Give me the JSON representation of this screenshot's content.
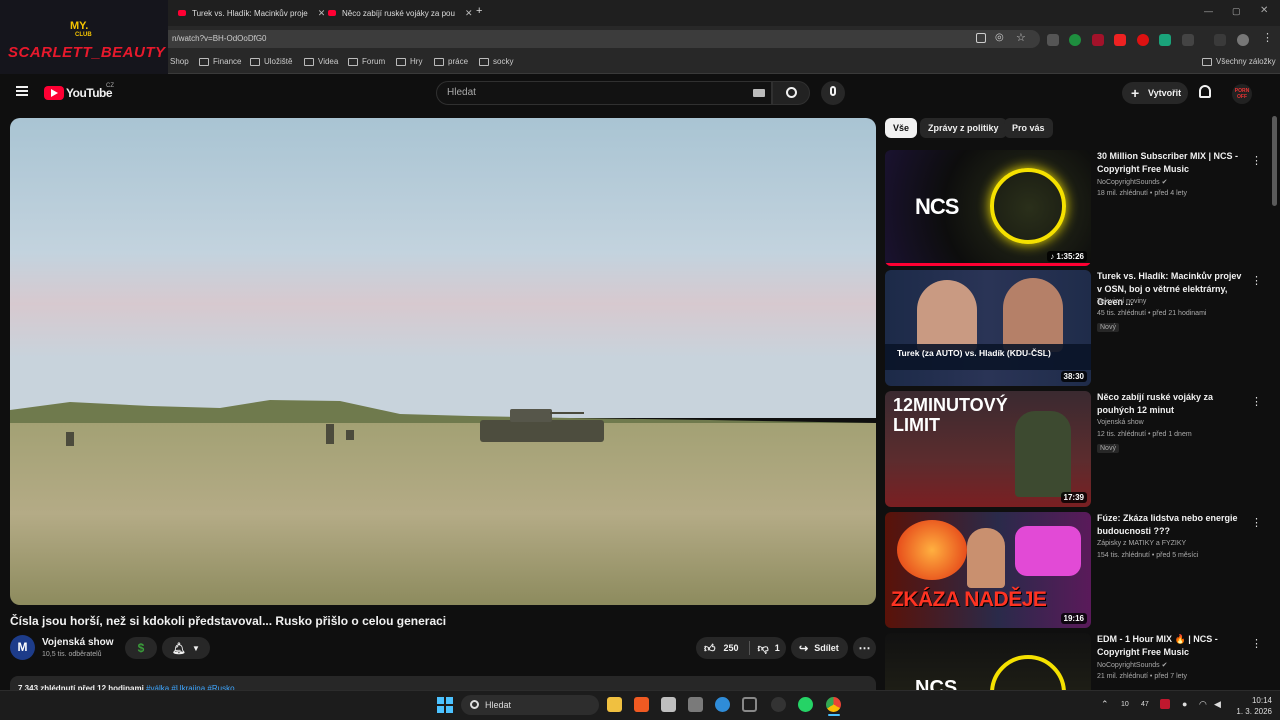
{
  "browser": {
    "tabs": [
      {
        "label": "Turek vs. Hladík: Macinkův proje"
      },
      {
        "label": "Něco zabíjí ruské vojáky za pou"
      }
    ],
    "new_tab_symbol": "+",
    "url": "n/watch?v=BH-OdOoDfG0",
    "bookmarks": [
      "Shop",
      "Finance",
      "Uložiště",
      "Videa",
      "Forum",
      "Hry",
      "práce",
      "socky"
    ],
    "all_bookmarks": "Všechny záložky"
  },
  "overlay": {
    "line1": "MY.",
    "line2": "CLUB",
    "brand": "SCARLETT_BEAUTY"
  },
  "youtube": {
    "logo_text": "YouTube",
    "country": "CZ",
    "search_placeholder": "Hledat",
    "create_label": "Vytvořit",
    "avatar_text": "PORN OFF"
  },
  "video": {
    "title": "Čísla jsou horší, než si kdokoli představoval... Rusko přišlo o celou generaci",
    "channel": "Vojenská show",
    "subscribers": "10,5 tis. odběratelů",
    "likes": "250",
    "dislikes": "1",
    "share_label": "Sdílet",
    "description": "7 343 zhlédnutí  před 12 hodinami",
    "hashtags": "#válka #Ukrajina #Rusko"
  },
  "chips": [
    "Vše",
    "Zprávy z politiky",
    "Pro vás"
  ],
  "related": [
    {
      "title": "30 Million Subscriber MIX | NCS - Copyright Free Music",
      "channel": "NoCopyrightSounds",
      "meta": "18 mil. zhlédnutí • před 4 lety",
      "duration": "1:35:26",
      "new": "",
      "thumb_text": "NCS"
    },
    {
      "title": "Turek vs. Hladík: Macinkův projev v OSN, boj o větrné elektrárny, Green ...",
      "channel": "Televizní noviny",
      "meta": "45 tis. zhlédnutí • před 21 hodinami",
      "duration": "38:30",
      "new": "Nový",
      "thumb_text": "Turek (za AUTO) vs. Hladík (KDU-ČSL)"
    },
    {
      "title": "Něco zabíjí ruské vojáky za pouhých 12 minut",
      "channel": "Vojenská show",
      "meta": "12 tis. zhlédnutí • před 1 dnem",
      "duration": "17:39",
      "new": "Nový",
      "thumb_text": "12MINUTOVÝ LIMIT"
    },
    {
      "title": "Fúze: Zkáza lidstva nebo energie budoucnosti ???",
      "channel": "Zápisky z MATIKY a FYZIKY",
      "meta": "154 tis. zhlédnutí • před 5 měsíci",
      "duration": "19:16",
      "new": "",
      "thumb_text": "ZKÁZA NADĚJE"
    },
    {
      "title": "EDM - 1 Hour MIX 🔥 | NCS - Copyright Free Music",
      "channel": "NoCopyrightSounds",
      "meta": "21 mil. zhlédnutí • před 7 lety",
      "duration": "",
      "new": "",
      "thumb_text": "NCS"
    }
  ],
  "taskbar": {
    "search": "Hledat",
    "time": "10:14",
    "date": "1. 3. 2026",
    "tray_a": "10",
    "tray_b": "47"
  }
}
